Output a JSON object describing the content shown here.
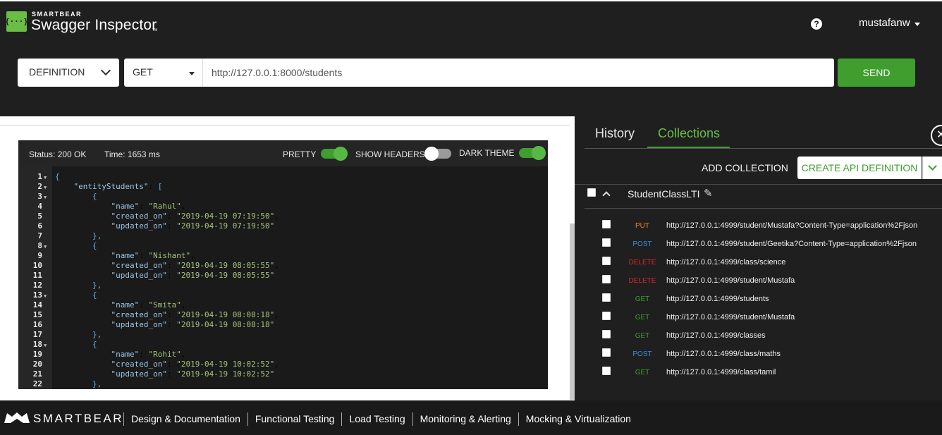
{
  "header": {
    "brand_small": "SMARTBEAR",
    "brand_title": "Swagger Inspector",
    "brand_tm": "TM",
    "help_icon": "?",
    "username": "mustafanw"
  },
  "request": {
    "definition_label": "DEFINITION",
    "method": "GET",
    "url": "http://127.0.0.1:8000/students",
    "send_label": "SEND"
  },
  "response": {
    "status": "Status: 200 OK",
    "time": "Time: 1653 ms",
    "pretty_label": "PRETTY",
    "pretty_on": true,
    "show_headers_label": "SHOW HEADERS",
    "show_headers_on": false,
    "dark_theme_label": "DARK THEME",
    "dark_theme_on": true,
    "lines": [
      {
        "n": "1",
        "fold": true,
        "parts": [
          [
            "p",
            "{"
          ]
        ]
      },
      {
        "n": "2",
        "fold": true,
        "parts": [
          [
            "t",
            "    "
          ],
          [
            "k",
            "\"entityStudents\""
          ],
          [
            "t",
            ": "
          ],
          [
            "p",
            "["
          ]
        ]
      },
      {
        "n": "3",
        "fold": true,
        "parts": [
          [
            "t",
            "        "
          ],
          [
            "p",
            "{"
          ]
        ]
      },
      {
        "n": "4",
        "fold": false,
        "parts": [
          [
            "t",
            "            "
          ],
          [
            "k",
            "\"name\""
          ],
          [
            "t",
            ": "
          ],
          [
            "s",
            "\"Rahul\""
          ],
          [
            "t",
            ","
          ]
        ]
      },
      {
        "n": "5",
        "fold": false,
        "parts": [
          [
            "t",
            "            "
          ],
          [
            "k",
            "\"created_on\""
          ],
          [
            "t",
            ": "
          ],
          [
            "s",
            "\"2019-04-19 07:19:50\""
          ],
          [
            "t",
            ","
          ]
        ]
      },
      {
        "n": "6",
        "fold": false,
        "parts": [
          [
            "t",
            "            "
          ],
          [
            "k",
            "\"updated_on\""
          ],
          [
            "t",
            ": "
          ],
          [
            "s",
            "\"2019-04-19 07:19:50\""
          ]
        ]
      },
      {
        "n": "7",
        "fold": false,
        "parts": [
          [
            "t",
            "        "
          ],
          [
            "p",
            "},"
          ]
        ]
      },
      {
        "n": "8",
        "fold": true,
        "parts": [
          [
            "t",
            "        "
          ],
          [
            "p",
            "{"
          ]
        ]
      },
      {
        "n": "9",
        "fold": false,
        "parts": [
          [
            "t",
            "            "
          ],
          [
            "k",
            "\"name\""
          ],
          [
            "t",
            ": "
          ],
          [
            "s",
            "\"Nishant\""
          ],
          [
            "t",
            ","
          ]
        ]
      },
      {
        "n": "10",
        "fold": false,
        "parts": [
          [
            "t",
            "            "
          ],
          [
            "k",
            "\"created_on\""
          ],
          [
            "t",
            ": "
          ],
          [
            "s",
            "\"2019-04-19 08:05:55\""
          ],
          [
            "t",
            ","
          ]
        ]
      },
      {
        "n": "11",
        "fold": false,
        "parts": [
          [
            "t",
            "            "
          ],
          [
            "k",
            "\"updated_on\""
          ],
          [
            "t",
            ": "
          ],
          [
            "s",
            "\"2019-04-19 08:05:55\""
          ]
        ]
      },
      {
        "n": "12",
        "fold": false,
        "parts": [
          [
            "t",
            "        "
          ],
          [
            "p",
            "},"
          ]
        ]
      },
      {
        "n": "13",
        "fold": true,
        "parts": [
          [
            "t",
            "        "
          ],
          [
            "p",
            "{"
          ]
        ]
      },
      {
        "n": "14",
        "fold": false,
        "parts": [
          [
            "t",
            "            "
          ],
          [
            "k",
            "\"name\""
          ],
          [
            "t",
            ": "
          ],
          [
            "s",
            "\"Smita\""
          ],
          [
            "t",
            ","
          ]
        ]
      },
      {
        "n": "15",
        "fold": false,
        "parts": [
          [
            "t",
            "            "
          ],
          [
            "k",
            "\"created_on\""
          ],
          [
            "t",
            ": "
          ],
          [
            "s",
            "\"2019-04-19 08:08:18\""
          ],
          [
            "t",
            ","
          ]
        ]
      },
      {
        "n": "16",
        "fold": false,
        "parts": [
          [
            "t",
            "            "
          ],
          [
            "k",
            "\"updated_on\""
          ],
          [
            "t",
            ": "
          ],
          [
            "s",
            "\"2019-04-19 08:08:18\""
          ]
        ]
      },
      {
        "n": "17",
        "fold": false,
        "parts": [
          [
            "t",
            "        "
          ],
          [
            "p",
            "},"
          ]
        ]
      },
      {
        "n": "18",
        "fold": true,
        "parts": [
          [
            "t",
            "        "
          ],
          [
            "p",
            "{"
          ]
        ]
      },
      {
        "n": "19",
        "fold": false,
        "parts": [
          [
            "t",
            "            "
          ],
          [
            "k",
            "\"name\""
          ],
          [
            "t",
            ": "
          ],
          [
            "s",
            "\"Rohit\""
          ],
          [
            "t",
            ","
          ]
        ]
      },
      {
        "n": "20",
        "fold": false,
        "parts": [
          [
            "t",
            "            "
          ],
          [
            "k",
            "\"created_on\""
          ],
          [
            "t",
            ": "
          ],
          [
            "s",
            "\"2019-04-19 10:02:52\""
          ],
          [
            "t",
            ","
          ]
        ]
      },
      {
        "n": "21",
        "fold": false,
        "parts": [
          [
            "t",
            "            "
          ],
          [
            "k",
            "\"updated_on\""
          ],
          [
            "t",
            ": "
          ],
          [
            "s",
            "\"2019-04-19 10:02:52\""
          ]
        ]
      },
      {
        "n": "22",
        "fold": false,
        "parts": [
          [
            "t",
            "        "
          ],
          [
            "p",
            "},"
          ]
        ]
      }
    ]
  },
  "panel": {
    "tab_history": "History",
    "tab_collections": "Collections",
    "add_collection": "ADD COLLECTION",
    "create_api": "CREATE API DEFINITION",
    "collection_name": "StudentClassLTI",
    "requests": [
      {
        "method": "PUT",
        "url": "http://127.0.0.1:4999/student/Mustafa?Content-Type=application%2Fjson"
      },
      {
        "method": "POST",
        "url": "http://127.0.0.1:4999/student/Geetika?Content-Type=application%2Fjson"
      },
      {
        "method": "DELETE",
        "url": "http://127.0.0.1:4999/class/science"
      },
      {
        "method": "DELETE",
        "url": "http://127.0.0.1:4999/student/Mustafa"
      },
      {
        "method": "GET",
        "url": "http://127.0.0.1:4999/students"
      },
      {
        "method": "GET",
        "url": "http://127.0.0.1:4999/student/Mustafa"
      },
      {
        "method": "GET",
        "url": "http://127.0.0.1:4999/classes"
      },
      {
        "method": "POST",
        "url": "http://127.0.0.1:4999/class/maths"
      },
      {
        "method": "GET",
        "url": "http://127.0.0.1:4999/class/tamil"
      }
    ],
    "method_colors": {
      "GET": "#3f9e2e",
      "POST": "#3b8fd8",
      "PUT": "#e08a1e",
      "DELETE": "#d9262a"
    }
  },
  "footer": {
    "brand": "SMARTBEAR",
    "nav": [
      "Design & Documentation",
      "Functional Testing",
      "Load Testing",
      "Monitoring & Alerting",
      "Mocking & Virtualization"
    ]
  }
}
